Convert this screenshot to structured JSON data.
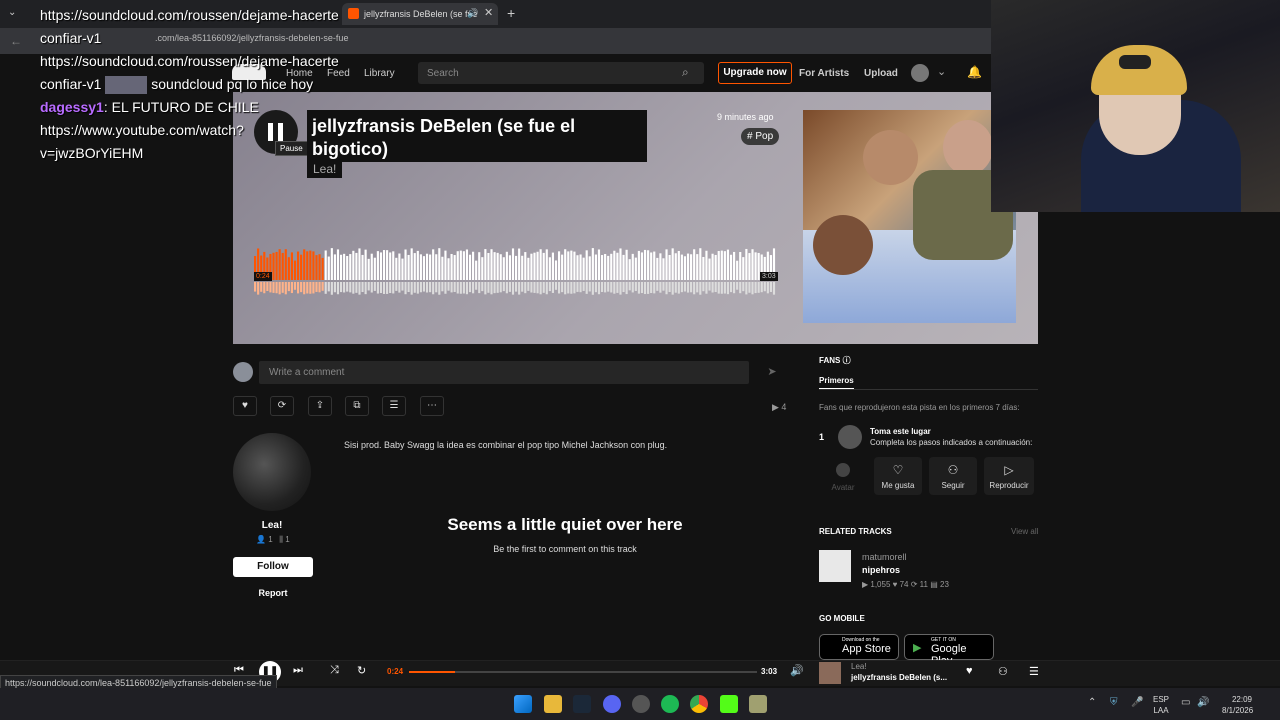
{
  "browser": {
    "tab_title": "jellyzfransis DeBelen (se fue",
    "url": ".com/lea-851166092/jellyzfransis-debelen-se-fue",
    "status_url": "https://soundcloud.com/lea-851166092/jellyzfransis-debelen-se-fue"
  },
  "nav": {
    "home": "Home",
    "feed": "Feed",
    "library": "Library",
    "search_placeholder": "Search",
    "upgrade": "Upgrade now",
    "for_artists": "For Artists",
    "upload": "Upload"
  },
  "track": {
    "title": "jellyzfransis DeBelen (se fue el bigotico)",
    "artist": "Lea!",
    "posted": "9 minutes ago",
    "tag": "# Pop",
    "pause_tooltip": "Pause",
    "elapsed": "0:24",
    "duration": "3:03",
    "progress": 0.131
  },
  "comment": {
    "placeholder": "Write a comment"
  },
  "actions": {
    "plays": "4"
  },
  "uploader": {
    "name": "Lea!",
    "followers": "1",
    "tracks": "1",
    "follow": "Follow",
    "report": "Report",
    "description": "Sisi prod. Baby Swagg la idea es combinar el pop tipo Michel Jachkson con plug."
  },
  "empty_comments": {
    "heading": "Seems a little quiet over here",
    "sub": "Be the first to comment on this track"
  },
  "fans": {
    "heading": "FANS",
    "tab": "Primeros",
    "desc": "Fans que reprodujeron esta pista en los primeros 7 días:",
    "rank": "1",
    "slot_title": "Toma este lugar",
    "slot_sub": "Completa los pasos indicados a continuación:",
    "avatar": "Avatar",
    "like": "Me gusta",
    "follow": "Seguir",
    "play": "Reproducir"
  },
  "related": {
    "heading": "RELATED TRACKS",
    "view_all": "View all",
    "artist": "matumorell",
    "title": "nipehros",
    "plays": "1,055",
    "likes": "74",
    "reposts": "11",
    "comments": "23"
  },
  "mobile": {
    "heading": "GO MOBILE",
    "appstore_small": "Download on the",
    "appstore": "App Store",
    "gplay_small": "GET IT ON",
    "gplay": "Google Play"
  },
  "player": {
    "elapsed": "0:24",
    "duration": "3:03",
    "artist": "Lea!",
    "title": "jellyzfransis DeBelen (s..."
  },
  "overlay": {
    "line1": "https://soundcloud.com/roussen/dejame-hacerte",
    "line2": "confiar-v1",
    "line3": "https://soundcloud.com/roussen/dejame-hacerte",
    "line4": "confiar-v1",
    "line4b": "soundcloud pq lo hice hoy",
    "user": "dagessy1",
    "line5": ": EL FUTURO DE CHILE",
    "line6": "https://www.youtube.com/watch?",
    "line7": "v=jwzBOrYiEHM"
  },
  "taskbar": {
    "lang": "ESP",
    "lang2": "LAA",
    "time": "22:09",
    "date": "8/1/2026"
  },
  "colors": {
    "accent": "#ff5500",
    "bg": "#121212"
  }
}
